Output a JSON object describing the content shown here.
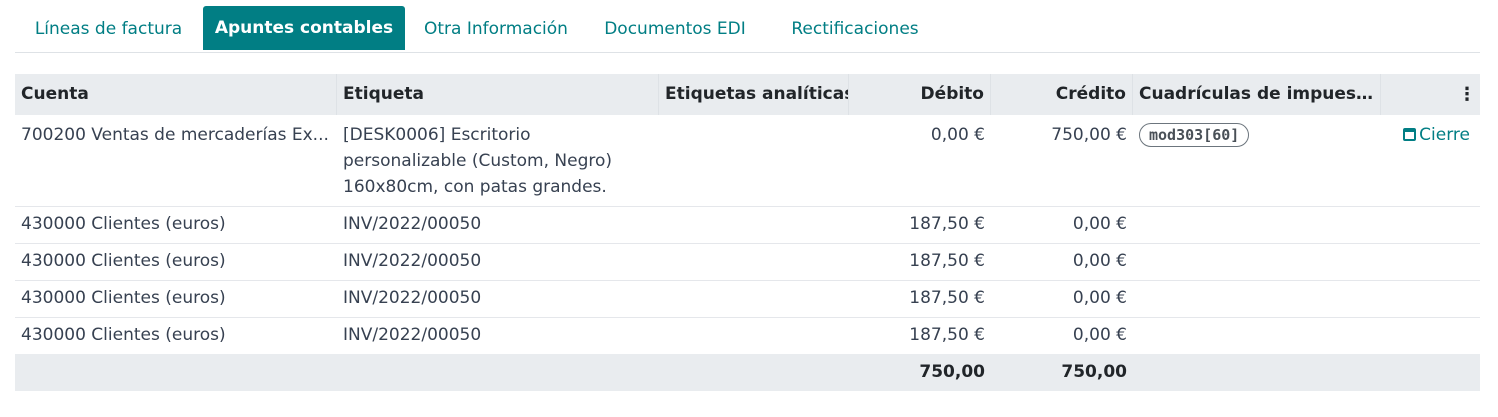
{
  "tabs": [
    {
      "label": "Líneas de factura",
      "active": false
    },
    {
      "label": "Apuntes contables",
      "active": true
    },
    {
      "label": "Otra Información",
      "active": false
    },
    {
      "label": "Documentos EDI",
      "active": false
    },
    {
      "label": "Rectificaciones",
      "active": false
    }
  ],
  "table": {
    "headers": {
      "cuenta": "Cuenta",
      "etiqueta": "Etiqueta",
      "analiticas": "Etiquetas analíticas",
      "debito": "Débito",
      "credito": "Crédito",
      "cuadriculas": "Cuadrículas de impuest..."
    },
    "rows": [
      {
        "cuenta": "700200 Ventas de mercaderías Ex...",
        "etiqueta": "[DESK0006] Escritorio personalizable (Custom, Negro) 160x80cm, con patas grandes.",
        "analiticas": "",
        "debito": "0,00 €",
        "credito": "750,00 €",
        "tag": "mod303[60]",
        "action": "Cierre"
      },
      {
        "cuenta": "430000 Clientes (euros)",
        "etiqueta": "INV/2022/00050",
        "analiticas": "",
        "debito": "187,50 €",
        "credito": "0,00 €"
      },
      {
        "cuenta": "430000 Clientes (euros)",
        "etiqueta": "INV/2022/00050",
        "analiticas": "",
        "debito": "187,50 €",
        "credito": "0,00 €"
      },
      {
        "cuenta": "430000 Clientes (euros)",
        "etiqueta": "INV/2022/00050",
        "analiticas": "",
        "debito": "187,50 €",
        "credito": "0,00 €"
      },
      {
        "cuenta": "430000 Clientes (euros)",
        "etiqueta": "INV/2022/00050",
        "analiticas": "",
        "debito": "187,50 €",
        "credito": "0,00 €"
      }
    ],
    "totals": {
      "debito": "750,00",
      "credito": "750,00"
    }
  },
  "colors": {
    "accent": "#017e84",
    "header_bg": "#e9ecef"
  },
  "icons": {
    "options": "vertical-dots-icon",
    "calendar": "calendar-icon"
  }
}
